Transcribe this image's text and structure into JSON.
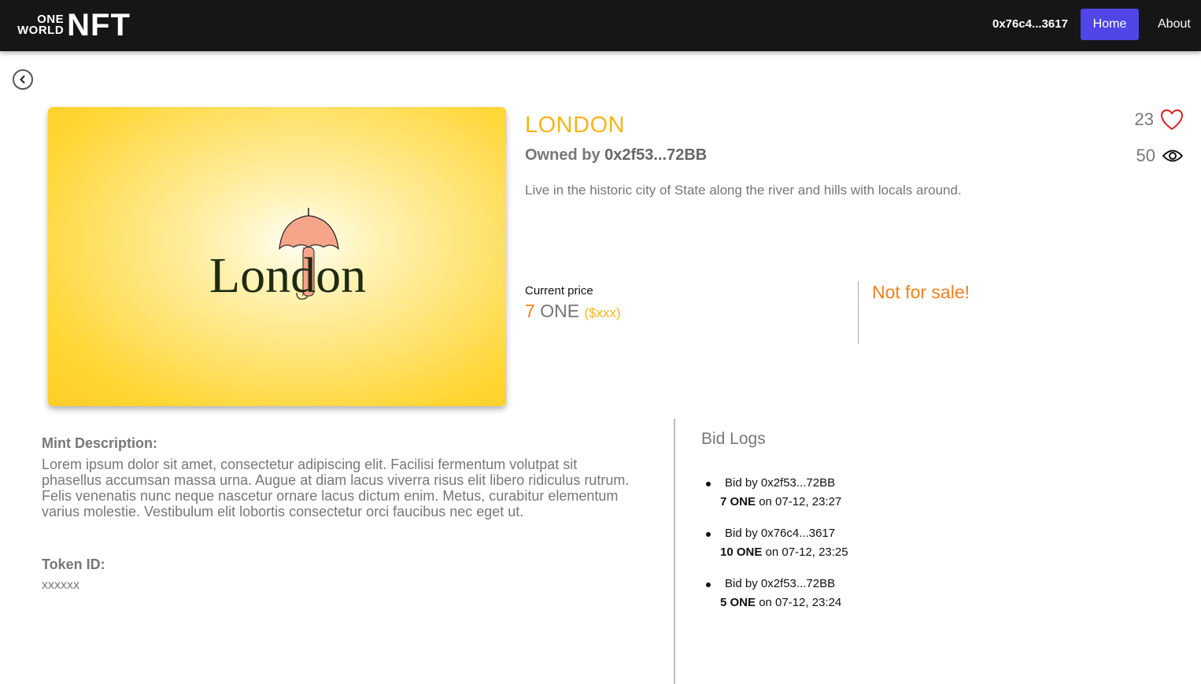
{
  "header": {
    "logo_small_top": "ONE",
    "logo_small_bottom": "WORLD",
    "logo_big": "NFT",
    "wallet": "0x76c4...3617",
    "nav": {
      "home": "Home",
      "about": "About"
    }
  },
  "nft": {
    "art_text": "London",
    "title": "LONDON",
    "owned_prefix": "Owned by",
    "owner": "0x2f53...72BB",
    "description": "Live in the historic city of State along the river and hills with locals around.",
    "likes": "23",
    "views": "50",
    "price_label": "Current price",
    "price_value": "7",
    "price_currency": "ONE",
    "price_usd": "($xxx)",
    "sale_status": "Not for sale!"
  },
  "mint": {
    "heading": "Mint Description:",
    "body": "Lorem ipsum dolor sit amet, consectetur adipiscing elit. Facilisi fermentum volutpat sit phasellus accumsan massa urna. Augue at diam lacus viverra risus elit libero ridiculus rutrum. Felis venenatis nunc neque nascetur ornare lacus dictum enim. Metus, curabitur elementum varius molestie. Vestibulum elit lobortis consectetur orci faucibus nec eget ut.",
    "token_heading": "Token ID:",
    "token_value": "xxxxxx"
  },
  "bids": {
    "heading": "Bid Logs",
    "items": [
      {
        "who": "Bid by 0x2f53...72BB",
        "amount": "7 ONE",
        "when": "on 07-12, 23:27"
      },
      {
        "who": "Bid by 0x76c4...3617",
        "amount": "10 ONE",
        "when": "on 07-12, 23:25"
      },
      {
        "who": "Bid by 0x2f53...72BB",
        "amount": "5 ONE",
        "when": "on 07-12, 23:24"
      }
    ]
  },
  "colors": {
    "header_bg": "#161616",
    "home_button": "#4f46e5",
    "title": "#f5b51c",
    "accent_orange": "#f2811d",
    "heart": "#e11d1d"
  },
  "icons": [
    "back-arrow-icon",
    "heart-icon",
    "eye-icon",
    "umbrella-icon"
  ]
}
